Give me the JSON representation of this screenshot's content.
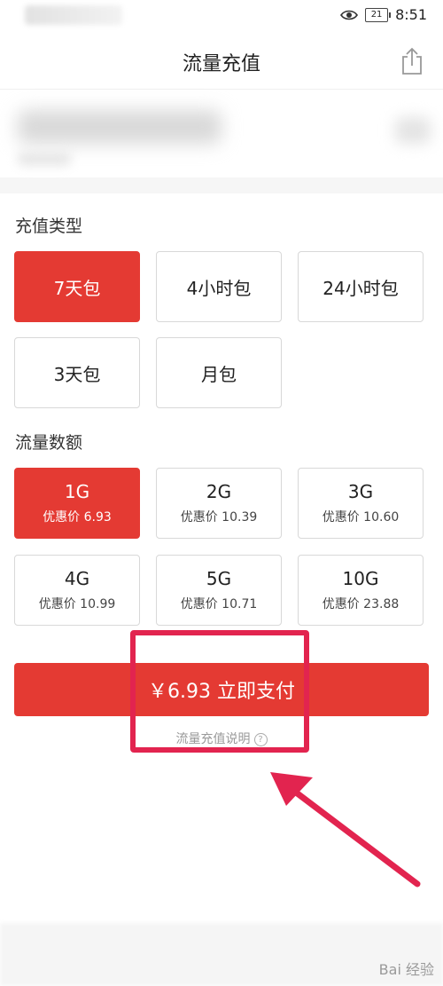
{
  "status_bar": {
    "time": "8:51",
    "battery": "21"
  },
  "header": {
    "title": "流量充值"
  },
  "sections": {
    "type_label": "充值类型",
    "amount_label": "流量数额"
  },
  "types": [
    {
      "label": "7天包",
      "selected": true
    },
    {
      "label": "4小时包",
      "selected": false
    },
    {
      "label": "24小时包",
      "selected": false
    },
    {
      "label": "3天包",
      "selected": false
    },
    {
      "label": "月包",
      "selected": false
    }
  ],
  "amounts": [
    {
      "size": "1G",
      "price": "优惠价 6.93",
      "selected": true
    },
    {
      "size": "2G",
      "price": "优惠价 10.39",
      "selected": false
    },
    {
      "size": "3G",
      "price": "优惠价 10.60",
      "selected": false
    },
    {
      "size": "4G",
      "price": "优惠价 10.99",
      "selected": false
    },
    {
      "size": "5G",
      "price": "优惠价 10.71",
      "selected": false
    },
    {
      "size": "10G",
      "price": "优惠价 23.88",
      "selected": false
    }
  ],
  "pay": {
    "label": "￥6.93 立即支付"
  },
  "help": {
    "label": "流量充值说明",
    "icon": "?"
  },
  "watermark": "Bai 经验",
  "colors": {
    "accent": "#e43a33",
    "annotation": "#e2244f"
  }
}
